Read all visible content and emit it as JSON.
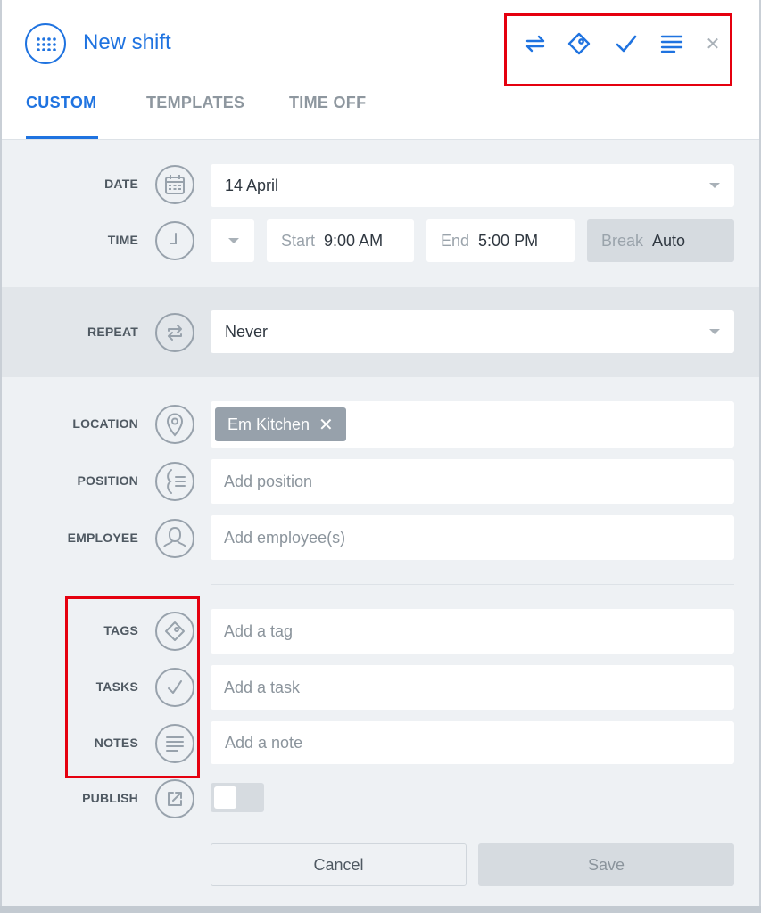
{
  "header": {
    "title": "New shift",
    "icons": [
      "calendar-list-icon",
      "repeat-icon",
      "tag-icon",
      "check-icon",
      "notes-icon",
      "close-icon"
    ],
    "close_glyph": "✕",
    "accent": "#1f73e0"
  },
  "tabs": [
    {
      "label": "CUSTOM",
      "active": true
    },
    {
      "label": "TEMPLATES",
      "active": false
    },
    {
      "label": "TIME OFF",
      "active": false
    }
  ],
  "form": {
    "date": {
      "label": "DATE",
      "value": "14 April"
    },
    "time": {
      "label": "TIME",
      "start_label": "Start",
      "start_value": "9:00 AM",
      "end_label": "End",
      "end_value": "5:00 PM",
      "break_label": "Break",
      "break_value": "Auto"
    },
    "repeat": {
      "label": "REPEAT",
      "value": "Never"
    },
    "location": {
      "label": "LOCATION",
      "chip": "Em Kitchen",
      "chip_remove": "✕"
    },
    "position": {
      "label": "POSITION",
      "placeholder": "Add position"
    },
    "employee": {
      "label": "EMPLOYEE",
      "placeholder": "Add employee(s)"
    },
    "tags": {
      "label": "TAGS",
      "placeholder": "Add a tag"
    },
    "tasks": {
      "label": "TASKS",
      "placeholder": "Add a task"
    },
    "notes": {
      "label": "NOTES",
      "placeholder": "Add a note"
    },
    "publish": {
      "label": "PUBLISH",
      "enabled": false
    }
  },
  "buttons": {
    "cancel": "Cancel",
    "save": "Save"
  },
  "annotation_color": "#e5000f"
}
